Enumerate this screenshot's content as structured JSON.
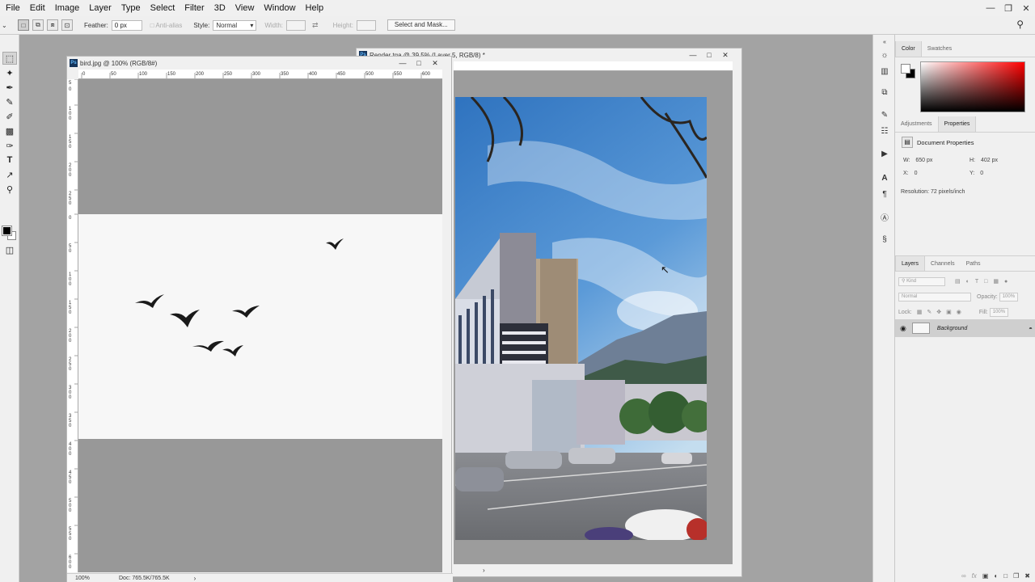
{
  "menubar": {
    "items": [
      "File",
      "Edit",
      "Image",
      "Layer",
      "Type",
      "Select",
      "Filter",
      "3D",
      "View",
      "Window",
      "Help"
    ]
  },
  "optionsbar": {
    "feather_label": "Feather:",
    "feather_value": "0 px",
    "antialias_label": "Anti-alias",
    "style_label": "Style:",
    "style_value": "Normal",
    "width_label": "Width:",
    "height_label": "Height:",
    "select_mask_label": "Select and Mask..."
  },
  "bird_doc": {
    "title": "bird.jpg @ 100% (RGB/8#)",
    "zoom": "100%",
    "doc_size": "Doc: 765.5K/765.5K",
    "ruler_h": [
      "0",
      "50",
      "100",
      "150",
      "200",
      "250",
      "300",
      "350",
      "400",
      "450",
      "500",
      "550",
      "600"
    ],
    "ruler_v": [
      "5",
      "0",
      "1\n0\n0",
      "1\n5\n0",
      "2\n0\n0",
      "2\n5\n0",
      "0",
      "5\n0",
      "1\n0\n0",
      "1\n5\n0",
      "2\n0\n0",
      "2\n5\n0",
      "3\n0\n0",
      "3\n5\n0",
      "4\n0\n0",
      "4\n5\n0",
      "5\n0\n0",
      "5\n5\n0",
      "6\n0\n0"
    ]
  },
  "render_doc": {
    "title": "Render tga @ 39.5% (Layer 5, RGB/8) *"
  },
  "color_panel": {
    "tabs": [
      "Color",
      "Swatches"
    ],
    "active_tab": "Color"
  },
  "properties_panel": {
    "tabs": [
      "Adjustments",
      "Properties"
    ],
    "active_tab": "Properties",
    "section_title": "Document Properties",
    "w_label": "W:",
    "w_value": "650 px",
    "h_label": "H:",
    "h_value": "402 px",
    "x_label": "X:",
    "x_value": "0",
    "y_label": "Y:",
    "y_value": "0",
    "resolution": "Resolution: 72 pixels/inch"
  },
  "layers_panel": {
    "tabs": [
      "Layers",
      "Channels",
      "Paths"
    ],
    "active_tab": "Layers",
    "filter_kind": "Kind",
    "blend_mode": "Normal",
    "opacity_label": "Opacity:",
    "opacity_value": "100%",
    "lock_label": "Lock:",
    "fill_label": "Fill:",
    "fill_value": "100%",
    "layers": [
      {
        "name": "Background"
      }
    ]
  }
}
